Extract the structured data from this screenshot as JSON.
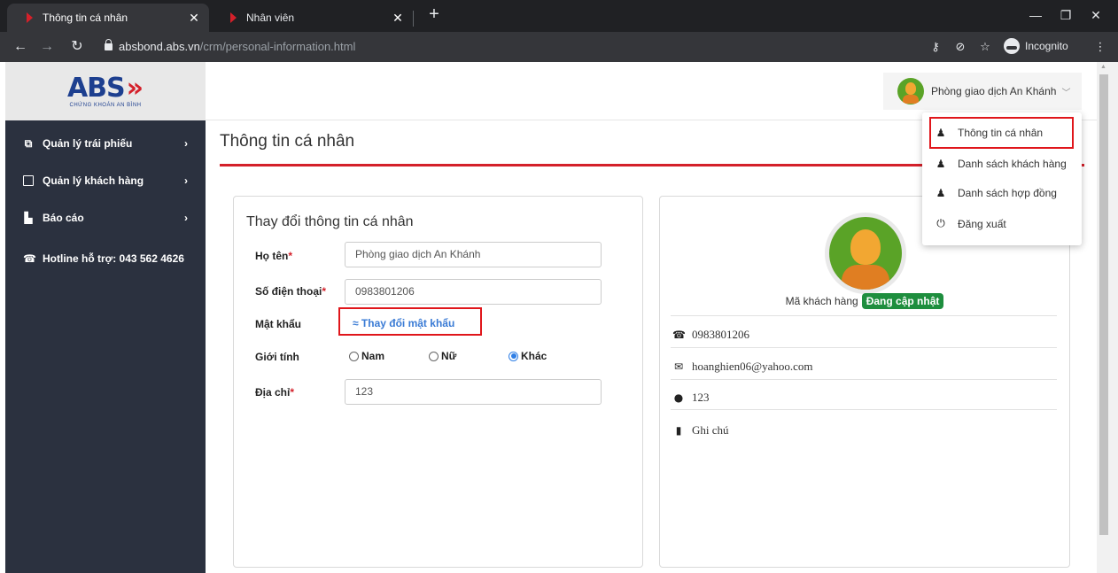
{
  "browser": {
    "tabs": [
      {
        "title": "Thông tin cá nhân",
        "active": true
      },
      {
        "title": "Nhân viên",
        "active": false
      }
    ],
    "url_host": "absbond.abs.vn",
    "url_path": "/crm/personal-information.html",
    "incognito_label": "Incognito"
  },
  "logo": {
    "brand": "ABS",
    "arrows": "»",
    "subtitle": "CHỨNG KHOÁN AN BÌNH"
  },
  "sidebar": {
    "items": [
      {
        "label": "Quản lý trái phiếu",
        "icon": "copy-icon"
      },
      {
        "label": "Quản lý khách hàng",
        "icon": "id-card-icon"
      },
      {
        "label": "Báo cáo",
        "icon": "chart-icon"
      },
      {
        "label": "Hotline hỗ trợ: 043 562 4626",
        "icon": "phone-icon"
      }
    ]
  },
  "header": {
    "user_name": "Phòng giao dịch An Khánh"
  },
  "page": {
    "title": "Thông tin cá nhân"
  },
  "form": {
    "title": "Thay đổi thông tin cá nhân",
    "name_label": "Họ tên",
    "name_value": "Phòng giao dịch An Khánh",
    "phone_label": "Số điện thoại",
    "phone_value": "0983801206",
    "password_label": "Mật khẩu",
    "password_link": "≈ Thay đổi mật khẩu",
    "gender_label": "Giới tính",
    "gender_options": [
      "Nam",
      "Nữ",
      "Khác"
    ],
    "gender_selected": "Khác",
    "address_label": "Địa chỉ",
    "address_value": "123",
    "required_mark": "*"
  },
  "profile": {
    "customer_code_label": "Mã khách hàng",
    "customer_code_badge": "Đang cập nhật",
    "phone": "0983801206",
    "email": "hoanghien06@yahoo.com",
    "address": "123",
    "note": "Ghi chú"
  },
  "dropdown": {
    "items": [
      {
        "label": "Thông tin cá nhân",
        "icon": "user-add-icon"
      },
      {
        "label": "Danh sách khách hàng",
        "icon": "user-add-icon"
      },
      {
        "label": "Danh sách hợp đồng",
        "icon": "user-add-icon"
      },
      {
        "label": "Đăng xuất",
        "icon": "power-icon"
      }
    ]
  },
  "colors": {
    "accent_red": "#d4202a",
    "sidebar_bg": "#2b313f",
    "badge_green": "#1e8e3e",
    "link_blue": "#3a7bd5"
  }
}
